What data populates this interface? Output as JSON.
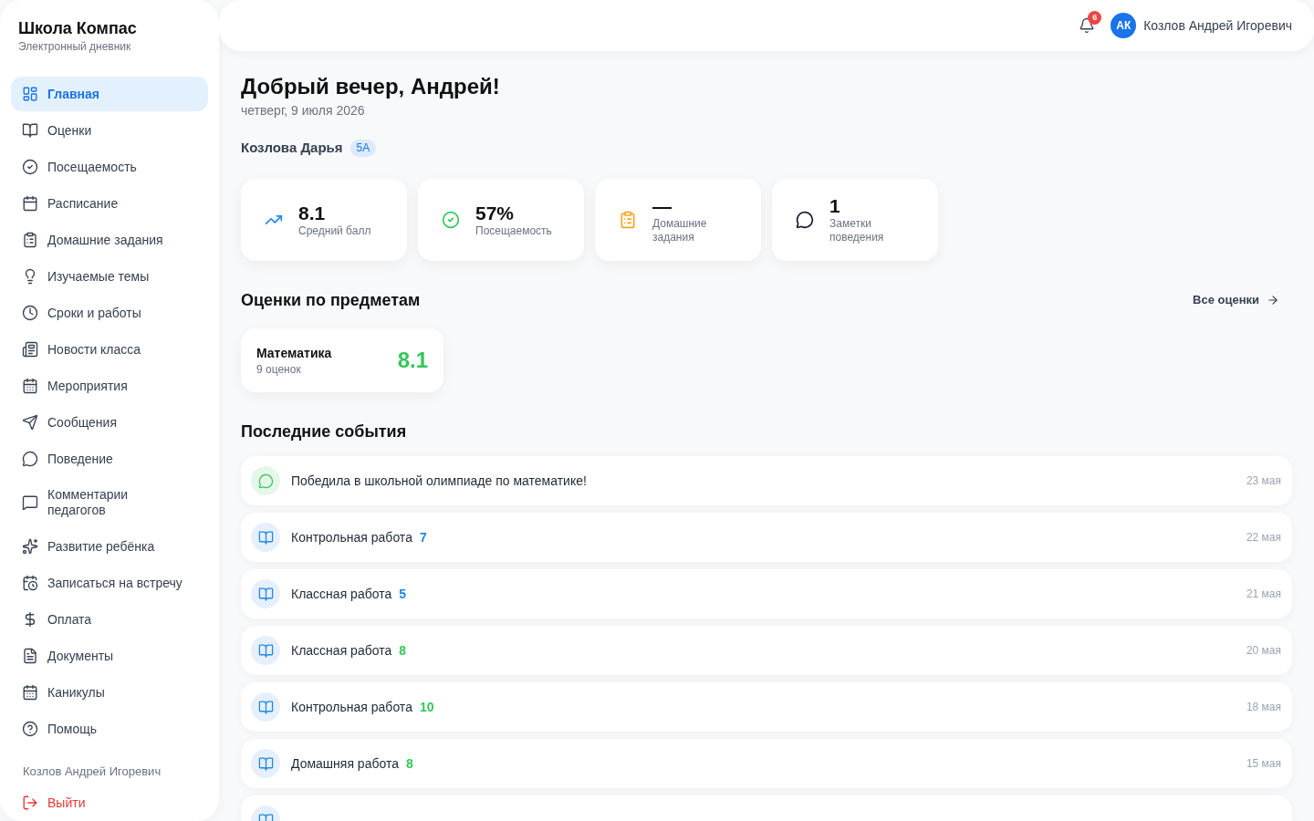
{
  "sidebar": {
    "brand": {
      "title": "Школа Компас",
      "subtitle": "Электронный дневник"
    },
    "items": [
      {
        "label": "Главная",
        "selected": true
      },
      {
        "label": "Оценки",
        "selected": false
      },
      {
        "label": "Посещаемость",
        "selected": false
      },
      {
        "label": "Расписание",
        "selected": false
      },
      {
        "label": "Домашние задания",
        "selected": false
      },
      {
        "label": "Изучаемые темы",
        "selected": false
      },
      {
        "label": "Сроки и работы",
        "selected": false
      },
      {
        "label": "Новости класса",
        "selected": false
      },
      {
        "label": "Мероприятия",
        "selected": false
      },
      {
        "label": "Сообщения",
        "selected": false
      },
      {
        "label": "Поведение",
        "selected": false
      },
      {
        "label": "Комментарии педагогов",
        "selected": false
      },
      {
        "label": "Развитие ребёнка",
        "selected": false
      },
      {
        "label": "Записаться на встречу",
        "selected": false
      },
      {
        "label": "Оплата",
        "selected": false
      },
      {
        "label": "Документы",
        "selected": false
      },
      {
        "label": "Каникулы",
        "selected": false
      },
      {
        "label": "Помощь",
        "selected": false
      }
    ],
    "user_name": "Козлов Андрей Игоревич",
    "logout": "Выйти"
  },
  "header": {
    "notifications_count": "6",
    "avatar_initials": "АК",
    "user_name": "Козлов Андрей Игоревич"
  },
  "greeting": {
    "title": "Добрый вечер, Андрей!",
    "date": "четверг, 9 июля 2026"
  },
  "student": {
    "name": "Козлова Дарья",
    "class": "5А"
  },
  "stats": [
    {
      "value": "8.1",
      "label": "Средний балл"
    },
    {
      "value": "57%",
      "label": "Посещаемость"
    },
    {
      "value": "—",
      "label": "Домашние задания"
    },
    {
      "value": "1",
      "label": "Заметки поведения"
    }
  ],
  "grades_section": {
    "title": "Оценки по предметам",
    "link": "Все оценки",
    "subjects": [
      {
        "name": "Математика",
        "count": "9 оценок",
        "average": "8.1"
      }
    ]
  },
  "events_section": {
    "title": "Последние события",
    "events": [
      {
        "kind": "achievement",
        "text": "Победила в школьной олимпиаде по математике!",
        "date": "23 мая"
      },
      {
        "kind": "grade",
        "text": "Контрольная работа",
        "grade": "7",
        "color": "#1e88e5",
        "date": "22 мая"
      },
      {
        "kind": "grade",
        "text": "Классная работа",
        "grade": "5",
        "color": "#1e88e5",
        "date": "21 мая"
      },
      {
        "kind": "grade",
        "text": "Классная работа",
        "grade": "8",
        "color": "#34c759",
        "date": "20 мая"
      },
      {
        "kind": "grade",
        "text": "Контрольная работа",
        "grade": "10",
        "color": "#34c759",
        "date": "18 мая"
      },
      {
        "kind": "grade",
        "text": "Домашняя работа",
        "grade": "8",
        "color": "#34c759",
        "date": "15 мая"
      },
      {
        "kind": "grade"
      }
    ]
  }
}
